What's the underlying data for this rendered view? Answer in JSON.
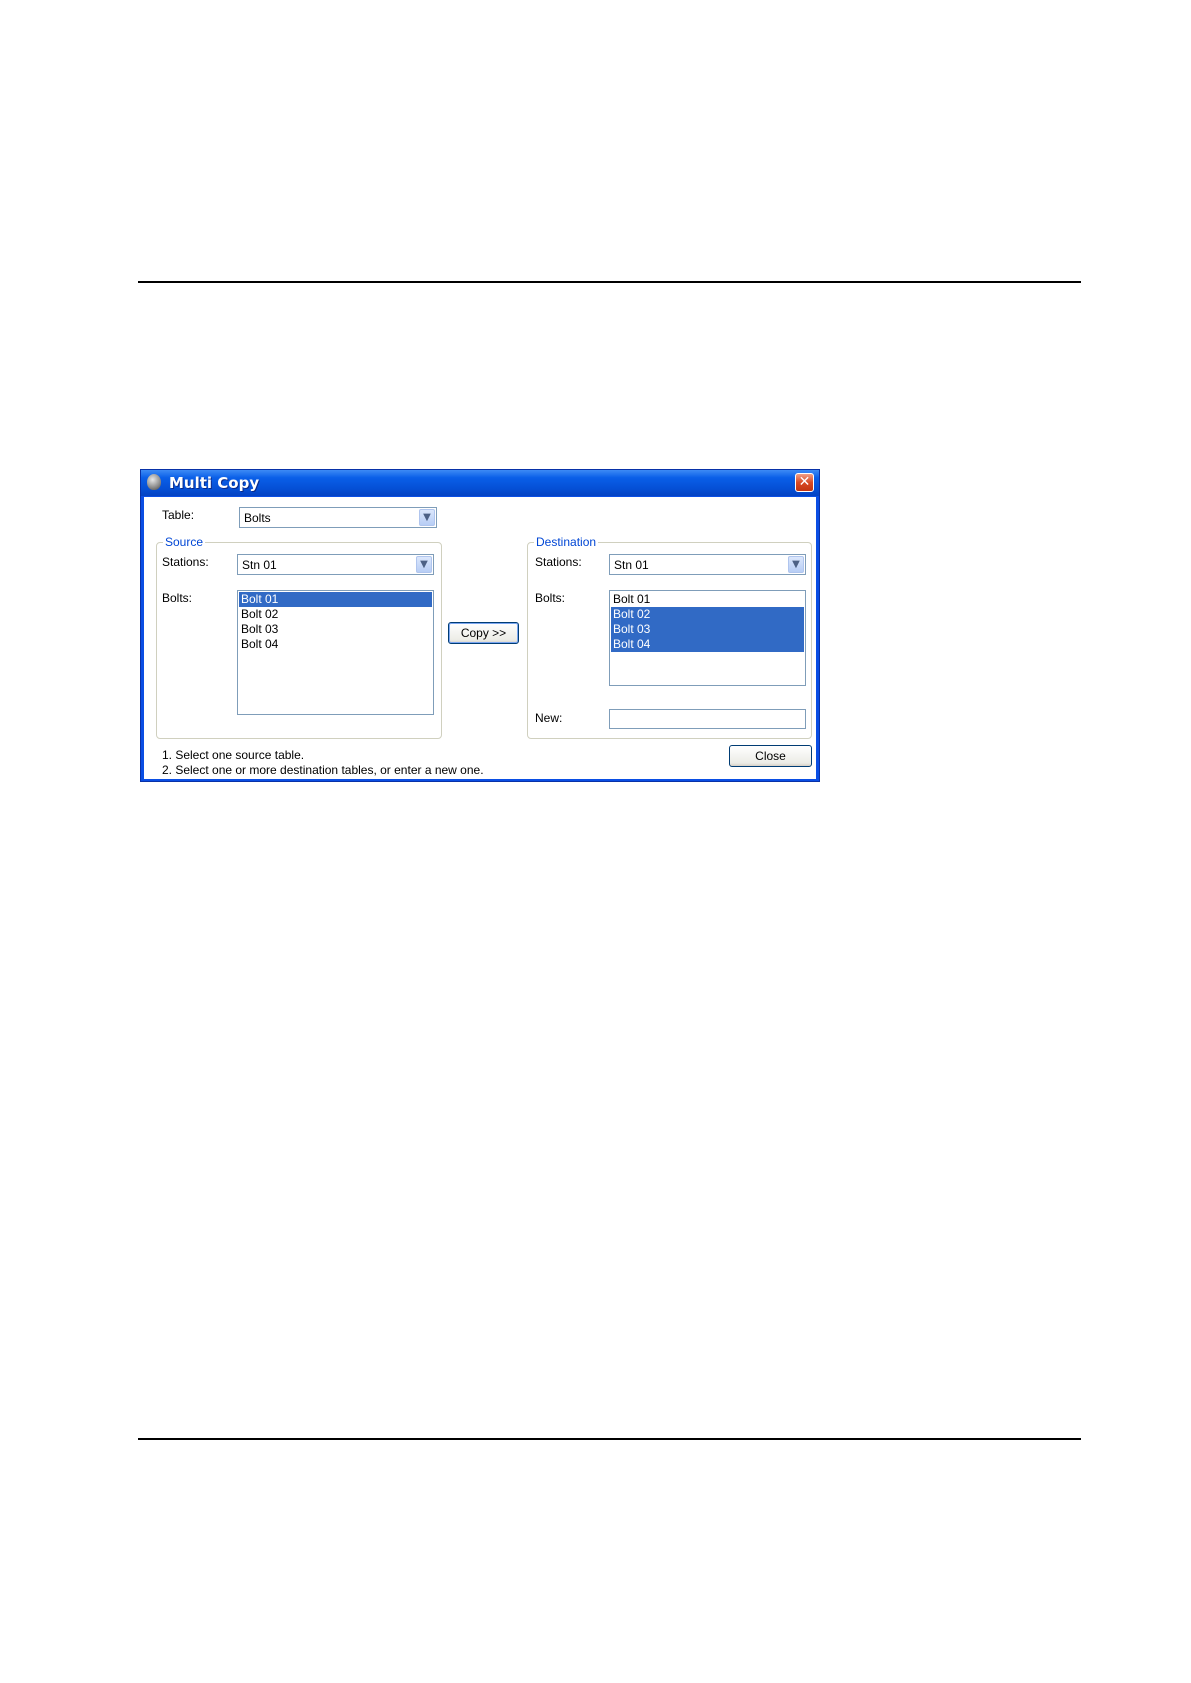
{
  "window": {
    "title": "Multi Copy",
    "close_glyph": "✕",
    "icon": "app-icon"
  },
  "table": {
    "label": "Table:",
    "value": "Bolts"
  },
  "source": {
    "group_title": "Source",
    "stations_label": "Stations:",
    "stations_value": "Stn 01",
    "bolts_label": "Bolts:",
    "items": [
      {
        "label": "Bolt 01",
        "selected": true
      },
      {
        "label": "Bolt 02",
        "selected": false
      },
      {
        "label": "Bolt 03",
        "selected": false
      },
      {
        "label": "Bolt 04",
        "selected": false
      }
    ]
  },
  "copy_button": "Copy >>",
  "destination": {
    "group_title": "Destination",
    "stations_label": "Stations:",
    "stations_value": "Stn 01",
    "bolts_label": "Bolts:",
    "items": [
      {
        "label": "Bolt 01",
        "selected": false
      },
      {
        "label": "Bolt 02",
        "selected": true
      },
      {
        "label": "Bolt 03",
        "selected": true
      },
      {
        "label": "Bolt 04",
        "selected": true
      }
    ],
    "new_label": "New:",
    "new_value": ""
  },
  "hints": [
    "1. Select one source table.",
    "2. Select one or more destination tables, or enter a new one."
  ],
  "close_button": "Close",
  "colors": {
    "selection": "#316ac5",
    "titlebar": "#0550d6",
    "group_title": "#0046d5"
  }
}
